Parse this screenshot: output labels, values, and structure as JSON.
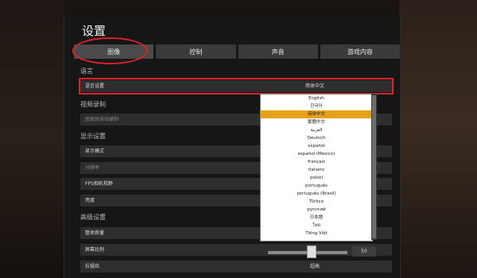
{
  "window": {
    "title": "设置"
  },
  "tabs": [
    "图像",
    "控制",
    "声音",
    "游戏内容"
  ],
  "sections": {
    "language": "语言",
    "video_record": "视频录制",
    "display": "显示设置",
    "advanced": "高级设置"
  },
  "rows": {
    "language_setting": {
      "label": "语言设置",
      "value": "简体中文"
    },
    "auto_record": {
      "label": "团本时自动录制"
    },
    "display_mode": {
      "label": "显示模式"
    },
    "resolution": {
      "label": "分辨率"
    },
    "fps_fov": {
      "label": "FPS相机视野"
    },
    "brightness": {
      "label": "亮度"
    },
    "overall_quality": {
      "label": "整体质量"
    },
    "screen_ratio": {
      "label": "屏幕比例",
      "value": "50",
      "fraction": 0.5
    },
    "antialias": {
      "label": "抗锯齿",
      "value": "超高"
    }
  },
  "language_options": [
    "English",
    "한국어",
    "简体中文",
    "繁體中文",
    "العربية",
    "Deutsch",
    "español",
    "español (México)",
    "français",
    "italiano",
    "polski",
    "português",
    "português (Brasil)",
    "Türkçe",
    "русский",
    "日本語",
    "ไทย",
    "Tiếng Việt"
  ],
  "selected_language_index": 2,
  "colors": {
    "accent": "#e8a21a",
    "highlight": "#d8232a"
  }
}
